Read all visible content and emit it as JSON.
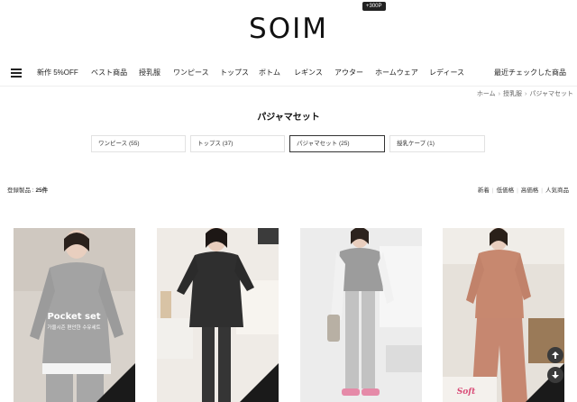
{
  "header": {
    "logo": "SOIM",
    "point_badge": "+300P"
  },
  "nav": {
    "items": [
      "新作 5%OFF",
      "ベスト商品",
      "授乳服",
      "ワンピース",
      "トップス",
      "ボトム",
      "レギンス",
      "アウター",
      "ホームウェア",
      "レディース"
    ],
    "recent": "最近チェックした商品"
  },
  "breadcrumb": [
    "ホーム",
    "授乳服",
    "パジャマセット"
  ],
  "page_title": "パジャマセット",
  "categories": [
    {
      "label": "ワンピース (55)",
      "active": false
    },
    {
      "label": "トップス (37)",
      "active": false
    },
    {
      "label": "パジャマセット (25)",
      "active": true
    },
    {
      "label": "授乳ケープ (1)",
      "active": false
    }
  ],
  "count": {
    "label": "登録製品 :",
    "value": "25件"
  },
  "sort_options": [
    "新着",
    "低価格",
    "高価格",
    "人気商品"
  ],
  "products": [
    {
      "overlay_title": "Pocket set",
      "overlay_sub": "가을시즌 편안한 수유세트",
      "bg": "#d9d4cf",
      "garment": "#9a9a9a"
    },
    {
      "overlay_title": "",
      "overlay_sub": "",
      "bg": "#ece8e3",
      "garment": "#3a3a3a"
    },
    {
      "overlay_title": "",
      "overlay_sub": "",
      "bg": "#e9e9e9",
      "garment": "#b9b9b9"
    },
    {
      "overlay_title": "Soft",
      "overlay_sub": "",
      "bg": "#e7e2dc",
      "garment": "#c98a74"
    }
  ],
  "colors": {
    "accent": "#222222",
    "border": "#e2e2e2"
  }
}
